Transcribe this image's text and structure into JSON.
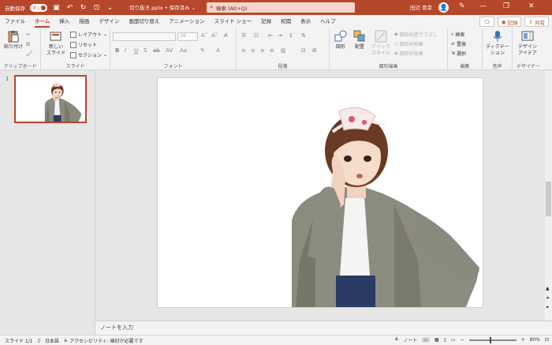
{
  "titlebar": {
    "autosave_label": "自動保存",
    "autosave_state": "オン",
    "document_title": "切り抜き.pptx • 保存済み ⌄",
    "search_placeholder": "検索 (Alt+Q)",
    "user_name": "田辺 育幸"
  },
  "tabs": [
    "ファイル",
    "ホーム",
    "挿入",
    "描画",
    "デザイン",
    "画面切り替え",
    "アニメーション",
    "スライド ショー",
    "記録",
    "校閲",
    "表示",
    "ヘルプ"
  ],
  "active_tab": "ホーム",
  "tab_actions": {
    "record": "記録",
    "share": "共有"
  },
  "ribbon": {
    "clipboard": {
      "label": "クリップボード",
      "paste": "貼り付け"
    },
    "slides": {
      "label": "スライド",
      "new_slide_line1": "新しい",
      "new_slide_line2": "スライド",
      "layout": "レイアウト",
      "reset": "リセット",
      "section": "セクション"
    },
    "font": {
      "label": "フォント",
      "bold": "B",
      "italic": "I",
      "underline": "U",
      "strike": "S",
      "font_size": "18"
    },
    "paragraph": {
      "label": "段落"
    },
    "drawing": {
      "label": "図形描画",
      "shapes": "図形",
      "arrange": "配置",
      "quick_styles_1": "クイック",
      "quick_styles_2": "スタイル",
      "fill": "図形の塗りつぶし",
      "outline": "図形の枠線",
      "effects": "図形の効果"
    },
    "editing": {
      "label": "編集",
      "find": "検索",
      "replace": "置換",
      "select": "選択"
    },
    "voice": {
      "label": "音声",
      "dictate_1": "ディクテー",
      "dictate_2": "ション"
    },
    "designer": {
      "label": "デザイナー",
      "design_1": "デザイン",
      "design_2": "アイデア"
    }
  },
  "slides_panel": {
    "slide_number": "1"
  },
  "notes_placeholder": "ノートを入力",
  "statusbar": {
    "slide_info": "スライド 1/1",
    "language": "日本語",
    "accessibility": "アクセシビリティ: 検討が必要です",
    "notes_button": "ノート",
    "zoom": "80%"
  },
  "colors": {
    "accent": "#b7472a",
    "ribbon_bg": "#f3f3f3",
    "workspace_bg": "#e6e6e6"
  }
}
